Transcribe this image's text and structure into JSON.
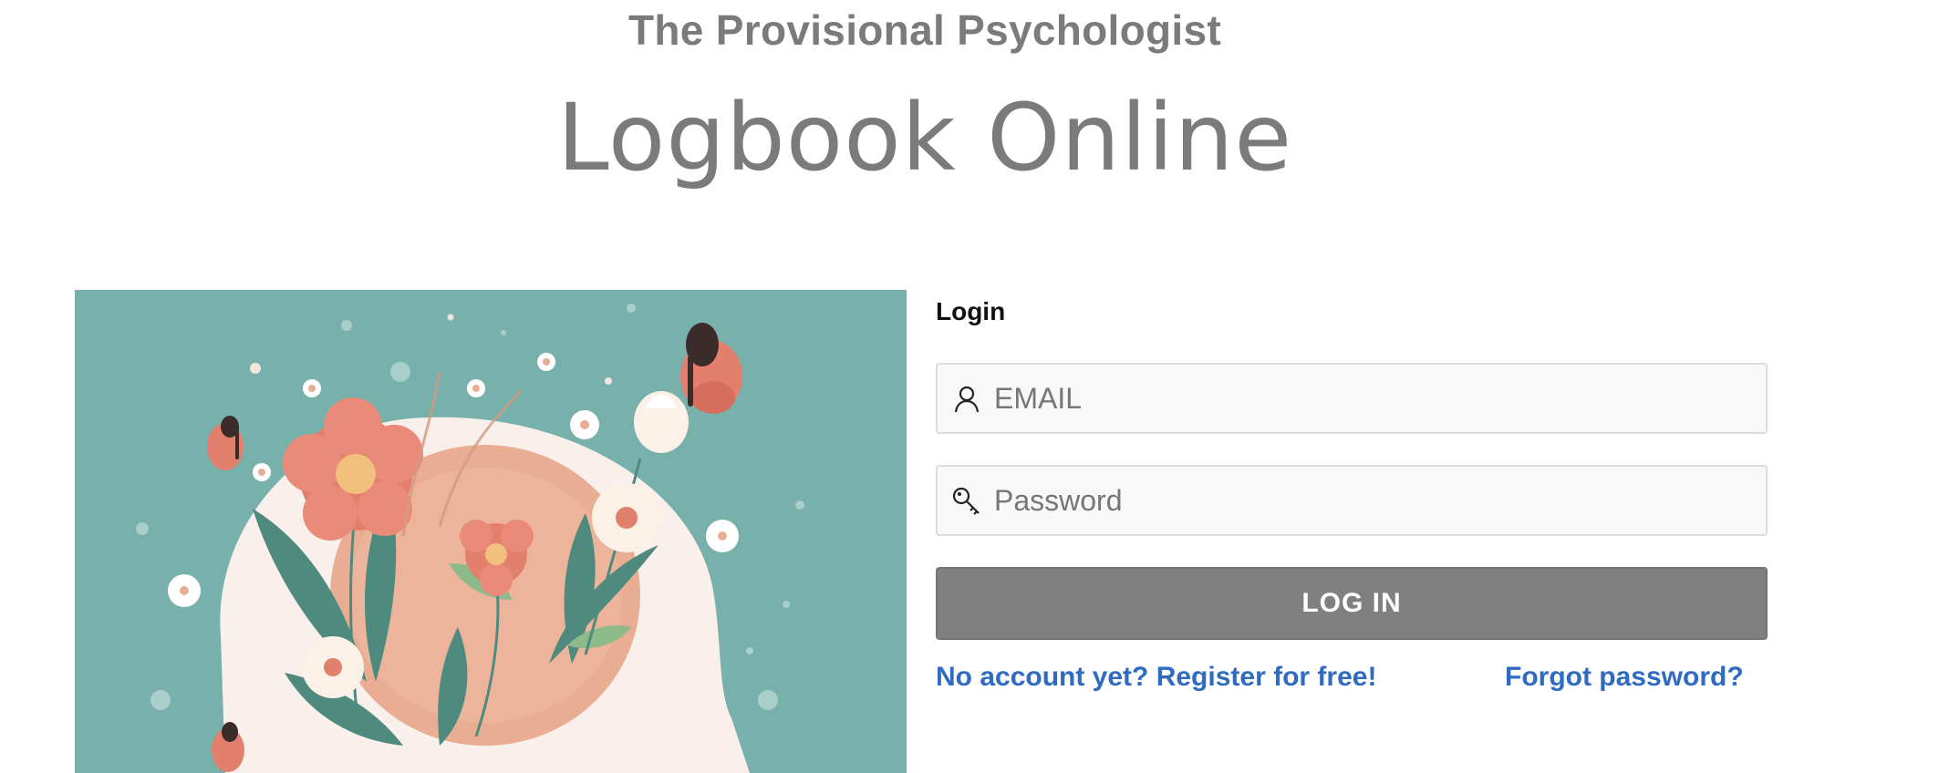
{
  "header": {
    "site_title": "The Provisional Psychologist",
    "app_title": "Logbook Online"
  },
  "login": {
    "heading": "Login",
    "email_placeholder": "EMAIL",
    "email_icon": "user-icon",
    "password_placeholder": "Password",
    "password_icon": "key-icon",
    "submit_label": "LOG IN",
    "register_link": "No account yet? Register for free!",
    "forgot_link": "Forgot password?"
  },
  "colors": {
    "title_text": "#7b7b7b",
    "hero_background": "#78b1ab",
    "button_background": "#808080",
    "link": "#2f6bc0",
    "field_background": "#f8f8f8"
  },
  "illustration": {
    "subject": "head silhouette with flowers and butterflies"
  }
}
